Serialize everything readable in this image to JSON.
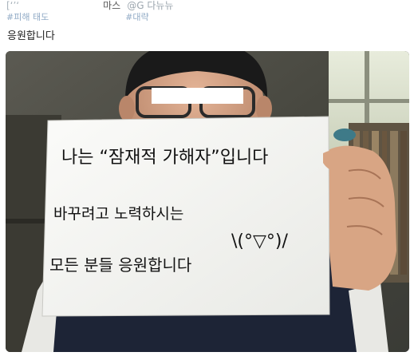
{
  "header": {
    "line1_left": "[‘’‘",
    "line1_name": "마스",
    "line1_handle": "@G 다뉴뉴",
    "line2_tag1": "#피해 태도",
    "line2_tag2": "#대략"
  },
  "tweet": {
    "text": "응원합니다"
  },
  "photo": {
    "sign": {
      "line1": "나는 “잠재적 가해자”입니다",
      "line2": "바꾸려고 노력하시는",
      "line3": "모든 분들  응원합니다",
      "emoticon": "\\(°▽°)/"
    }
  },
  "colors": {
    "wall": "#4a4a44",
    "paper": "#f6f6f4",
    "shirt": "#1d2436",
    "hair": "#1a1a1a",
    "skin": "#d9a88a"
  }
}
